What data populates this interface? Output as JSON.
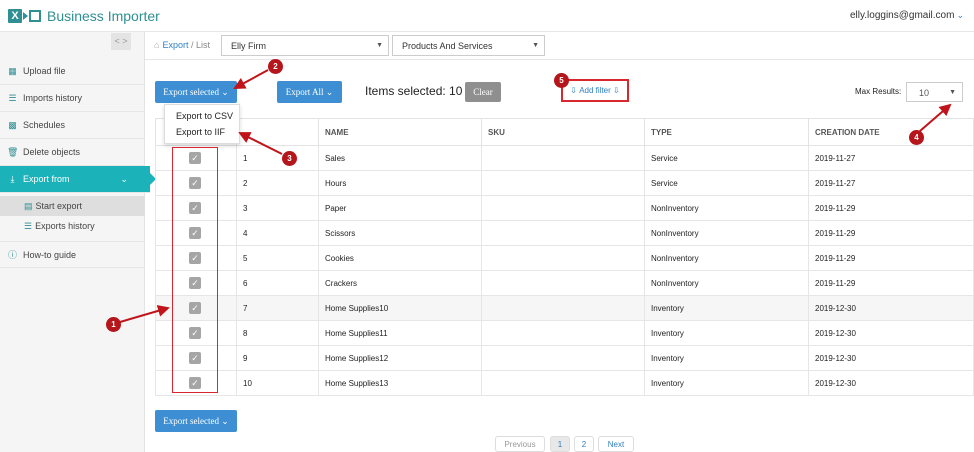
{
  "app": {
    "title": "Business Importer",
    "user_email": "elly.loggins@gmail.com"
  },
  "sidebar": {
    "collapse_label": "< >",
    "items": [
      {
        "label": "Upload file"
      },
      {
        "label": "Imports history"
      },
      {
        "label": "Schedules"
      },
      {
        "label": "Delete objects"
      },
      {
        "label": "Export from"
      },
      {
        "label": "Start export"
      },
      {
        "label": "Exports history"
      },
      {
        "label": "How-to guide"
      }
    ]
  },
  "breadcrumb": {
    "export": "Export",
    "separator": "/",
    "list": "List"
  },
  "filters": {
    "company": "Elly Firm",
    "entity": "Products And Services"
  },
  "toolbar": {
    "export_selected": "Export selected",
    "export_all": "Export All",
    "items_selected": "Items selected: 10",
    "clear": "Clear",
    "add_filter": "Add filter",
    "max_results_label": "Max Results:",
    "max_results_value": "10"
  },
  "dropdown": {
    "csv": "Export to CSV",
    "iif": "Export to IIF"
  },
  "table": {
    "headers": [
      "",
      "",
      "NAME",
      "SKU",
      "TYPE",
      "CREATION DATE"
    ],
    "rows": [
      {
        "n": "1",
        "name": "Sales",
        "sku": "",
        "type": "Service",
        "date": "2019-11-27"
      },
      {
        "n": "2",
        "name": "Hours",
        "sku": "",
        "type": "Service",
        "date": "2019-11-27"
      },
      {
        "n": "3",
        "name": "Paper",
        "sku": "",
        "type": "NonInventory",
        "date": "2019-11-29"
      },
      {
        "n": "4",
        "name": "Scissors",
        "sku": "",
        "type": "NonInventory",
        "date": "2019-11-29"
      },
      {
        "n": "5",
        "name": "Cookies",
        "sku": "",
        "type": "NonInventory",
        "date": "2019-11-29"
      },
      {
        "n": "6",
        "name": "Crackers",
        "sku": "",
        "type": "NonInventory",
        "date": "2019-11-29"
      },
      {
        "n": "7",
        "name": "Home Supplies10",
        "sku": "",
        "type": "Inventory",
        "date": "2019-12-30"
      },
      {
        "n": "8",
        "name": "Home Supplies11",
        "sku": "",
        "type": "Inventory",
        "date": "2019-12-30"
      },
      {
        "n": "9",
        "name": "Home Supplies12",
        "sku": "",
        "type": "Inventory",
        "date": "2019-12-30"
      },
      {
        "n": "10",
        "name": "Home Supplies13",
        "sku": "",
        "type": "Inventory",
        "date": "2019-12-30"
      }
    ]
  },
  "pagination": {
    "previous": "Previous",
    "page1": "1",
    "page2": "2",
    "next": "Next"
  },
  "annotations": {
    "m1": "1",
    "m2": "2",
    "m3": "3",
    "m4": "4",
    "m5": "5"
  },
  "colors": {
    "accent": "#1bb3b9",
    "brand": "#2f8f93",
    "button": "#3d8ed2",
    "annotation": "#b4161c"
  }
}
